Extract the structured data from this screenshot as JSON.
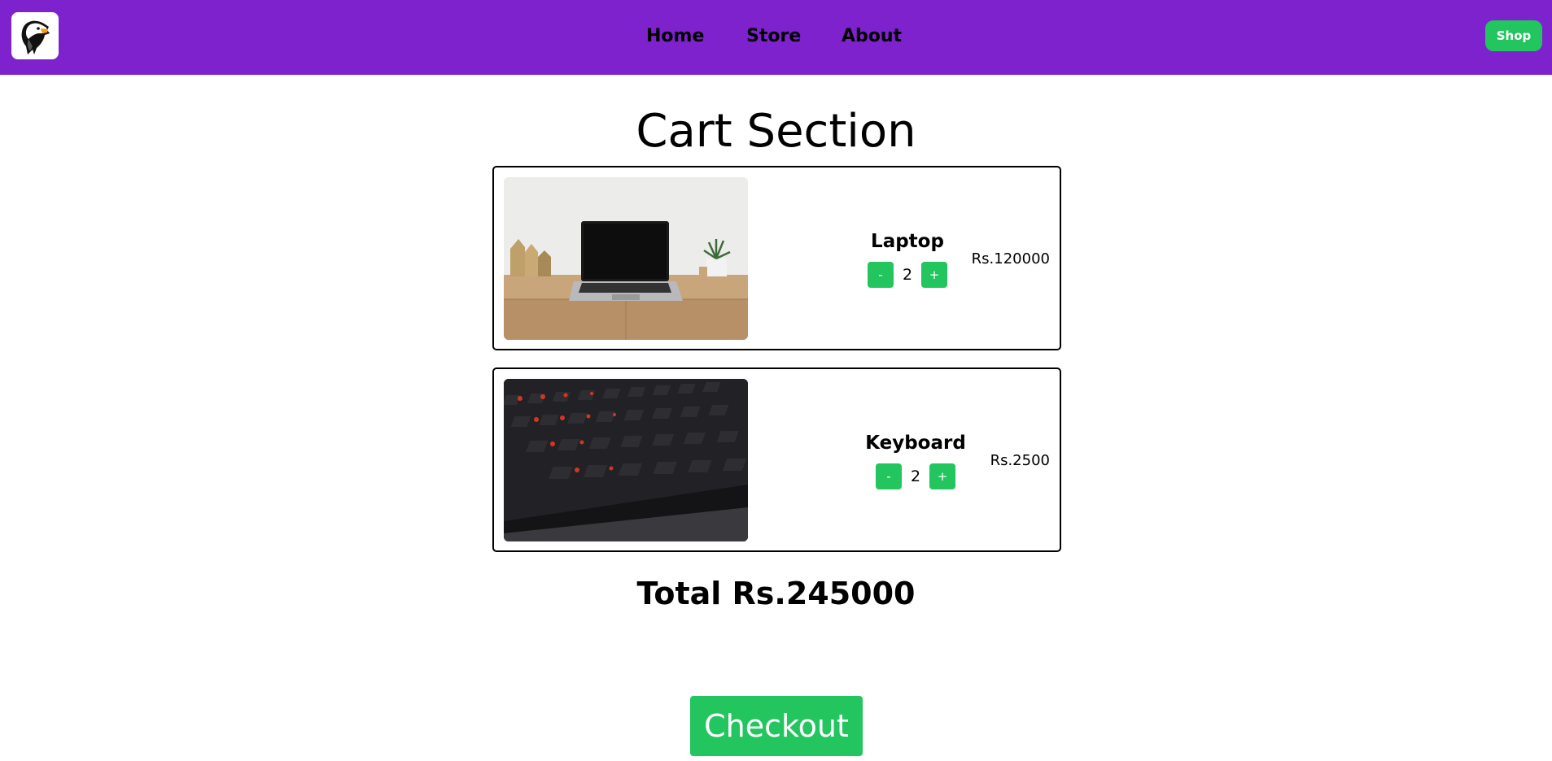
{
  "nav": {
    "links": [
      "Home",
      "Store",
      "About"
    ],
    "shop_label": "Shop"
  },
  "title": "Cart Section",
  "items": [
    {
      "name": "Laptop",
      "qty": "2",
      "minus": "-",
      "plus": "+",
      "price": "Rs.120000",
      "image": "laptop-photo"
    },
    {
      "name": "Keyboard",
      "qty": "2",
      "minus": "-",
      "plus": "+",
      "price": "Rs.2500",
      "image": "keyboard-photo"
    }
  ],
  "total": "Total Rs.245000",
  "checkout_label": "Checkout",
  "colors": {
    "navbar": "#7e22ce",
    "accent": "#22c55e"
  }
}
